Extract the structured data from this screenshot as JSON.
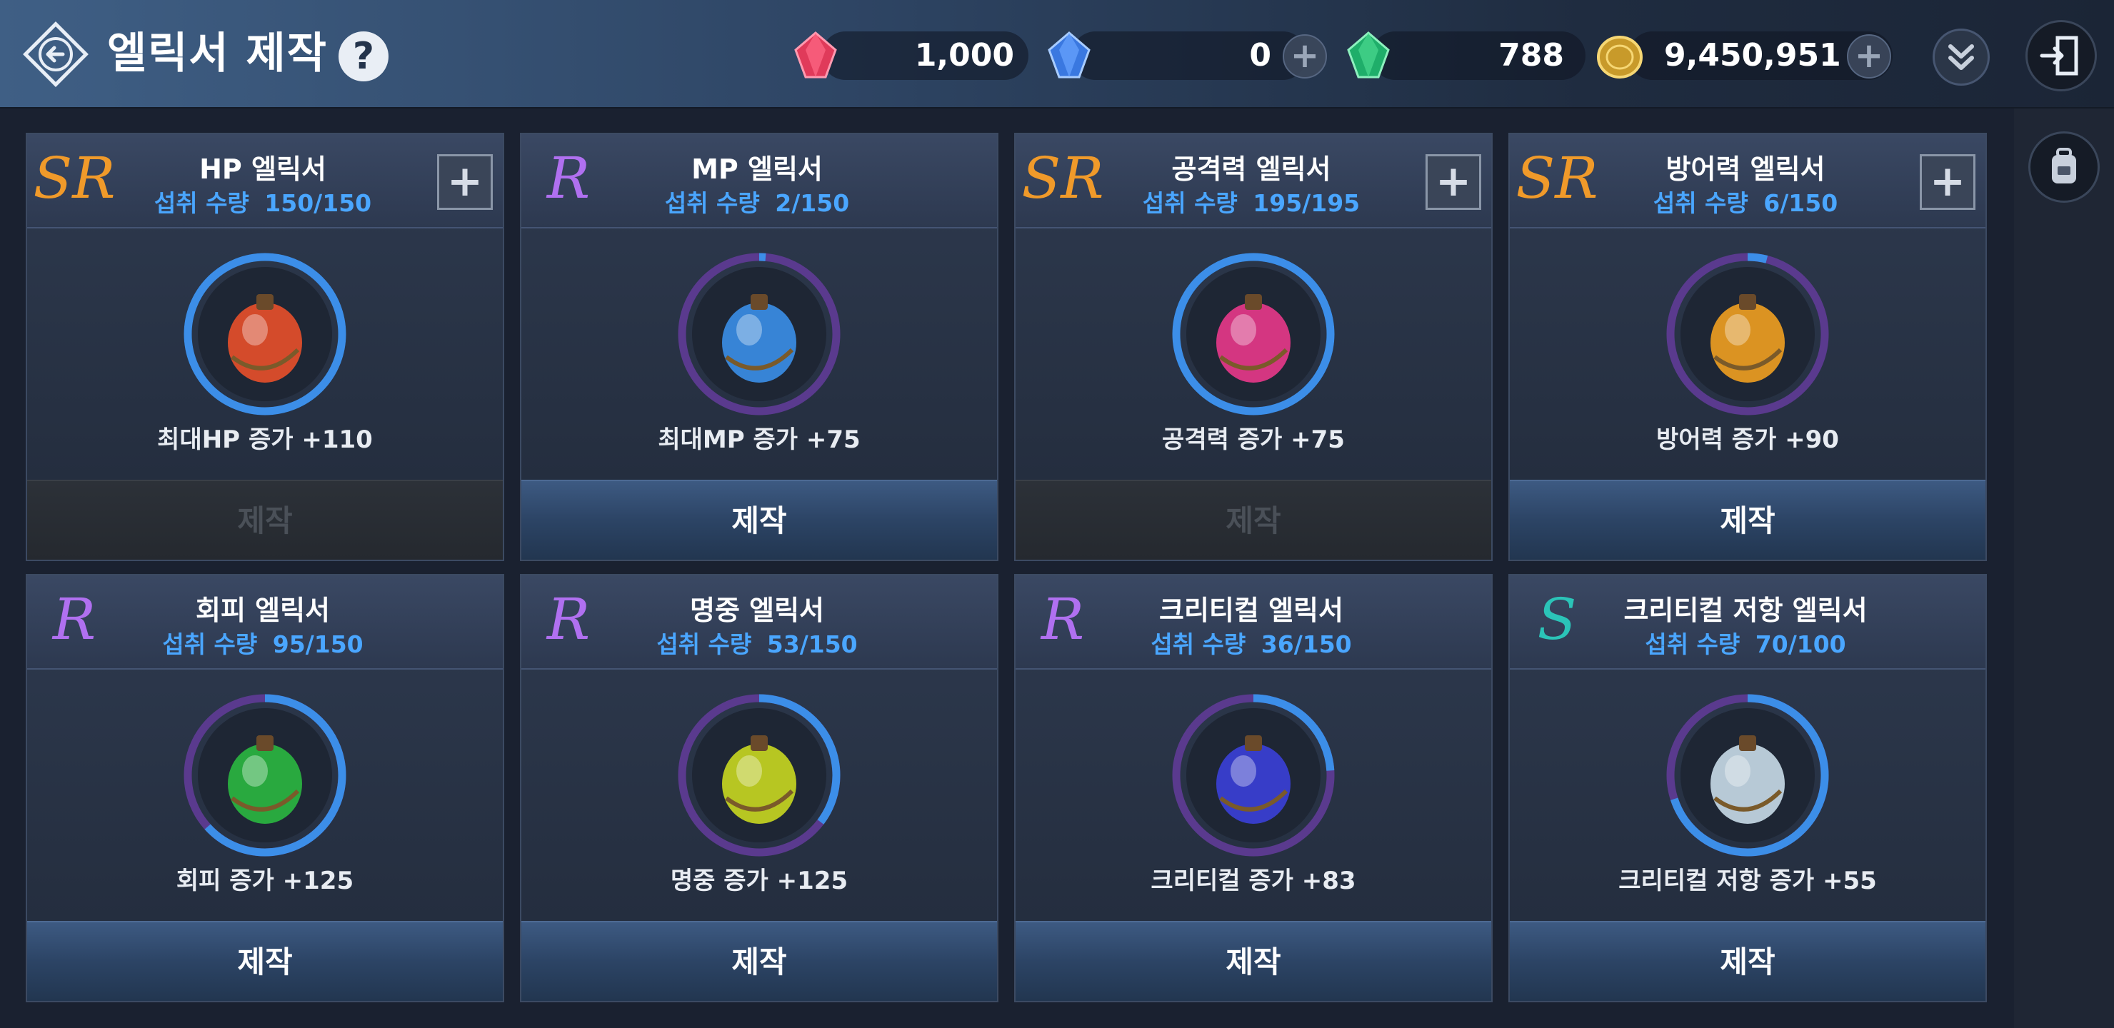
{
  "header": {
    "title": "엘릭서 제작",
    "help_label": "?"
  },
  "currencies": [
    {
      "icon": "red-gem-icon",
      "value": "1,000",
      "addable": false
    },
    {
      "icon": "blue-gem-icon",
      "value": "0",
      "addable": true
    },
    {
      "icon": "green-gem-icon",
      "value": "788",
      "addable": false
    },
    {
      "icon": "gold-coin-icon",
      "value": "9,450,951",
      "addable": true
    }
  ],
  "plus_label": "+",
  "colors": {
    "grade_SR": "#f09a2a",
    "grade_R": "#b070f0",
    "grade_S": "#2bc4b8",
    "ring_filled": "#3c8ee8",
    "ring_empty": "#5a3a8e",
    "qty_text": "#4aa6ff"
  },
  "cards": [
    {
      "grade": "SR",
      "title": "HP 엘릭서",
      "qty_label": "섭취 수량",
      "qty": "150/150",
      "current": 150,
      "max": 150,
      "effect": "최대HP 증가 +110",
      "craft_label": "제작",
      "craft_enabled": false,
      "has_plus": true,
      "potion_color": "#e8502a",
      "potion_icon": "red-potion-icon"
    },
    {
      "grade": "R",
      "title": "MP 엘릭서",
      "qty_label": "섭취 수량",
      "qty": "2/150",
      "current": 2,
      "max": 150,
      "effect": "최대MP 증가 +75",
      "craft_label": "제작",
      "craft_enabled": true,
      "has_plus": false,
      "potion_color": "#3a8fe8",
      "potion_icon": "blue-potion-icon"
    },
    {
      "grade": "SR",
      "title": "공격력 엘릭서",
      "qty_label": "섭취 수량",
      "qty": "195/195",
      "current": 195,
      "max": 195,
      "effect": "공격력 증가 +75",
      "craft_label": "제작",
      "craft_enabled": false,
      "has_plus": true,
      "potion_color": "#e8388a",
      "potion_icon": "pink-potion-icon"
    },
    {
      "grade": "SR",
      "title": "방어력 엘릭서",
      "qty_label": "섭취 수량",
      "qty": "6/150",
      "current": 6,
      "max": 150,
      "effect": "방어력 증가 +90",
      "craft_label": "제작",
      "craft_enabled": true,
      "has_plus": true,
      "potion_color": "#f0a020",
      "potion_icon": "orange-potion-icon"
    },
    {
      "grade": "R",
      "title": "회피 엘릭서",
      "qty_label": "섭취 수량",
      "qty": "95/150",
      "current": 95,
      "max": 150,
      "effect": "회피 증가 +125",
      "craft_label": "제작",
      "craft_enabled": true,
      "has_plus": false,
      "potion_color": "#2ab840",
      "potion_icon": "green-potion-icon"
    },
    {
      "grade": "R",
      "title": "명중 엘릭서",
      "qty_label": "섭취 수량",
      "qty": "53/150",
      "current": 53,
      "max": 150,
      "effect": "명중 증가 +125",
      "craft_label": "제작",
      "craft_enabled": true,
      "has_plus": false,
      "potion_color": "#c8d820",
      "potion_icon": "yellow-potion-icon"
    },
    {
      "grade": "R",
      "title": "크리티컬 엘릭서",
      "qty_label": "섭취 수량",
      "qty": "36/150",
      "current": 36,
      "max": 150,
      "effect": "크리티컬 증가 +83",
      "craft_label": "제작",
      "craft_enabled": true,
      "has_plus": false,
      "potion_color": "#3a40d8",
      "potion_icon": "indigo-potion-icon"
    },
    {
      "grade": "S",
      "title": "크리티컬 저항 엘릭서",
      "qty_label": "섭취 수량",
      "qty": "70/100",
      "current": 70,
      "max": 100,
      "effect": "크리티컬 저항 증가 +55",
      "craft_label": "제작",
      "craft_enabled": true,
      "has_plus": false,
      "potion_color": "#c8dce8",
      "potion_icon": "white-potion-icon"
    }
  ]
}
